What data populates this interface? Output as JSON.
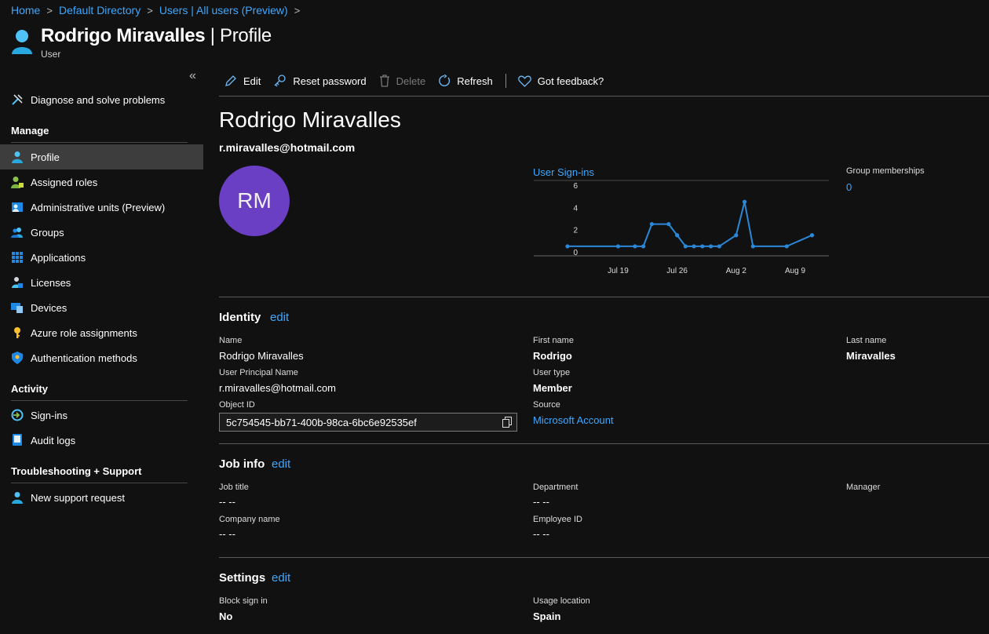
{
  "breadcrumb": [
    "Home",
    "Default Directory",
    "Users | All users (Preview)"
  ],
  "header": {
    "title_name": "Rodrigo Miravalles",
    "title_suffix": " | Profile",
    "subtitle": "User"
  },
  "sidebar": {
    "collapse_glyph": "«",
    "top_item": "Diagnose and solve problems",
    "sections": {
      "manage": "Manage",
      "activity": "Activity",
      "troubleshooting": "Troubleshooting + Support"
    },
    "manage_items": [
      "Profile",
      "Assigned roles",
      "Administrative units (Preview)",
      "Groups",
      "Applications",
      "Licenses",
      "Devices",
      "Azure role assignments",
      "Authentication methods"
    ],
    "activity_items": [
      "Sign-ins",
      "Audit logs"
    ],
    "support_items": [
      "New support request"
    ],
    "active_item": "Profile"
  },
  "toolbar": {
    "edit": "Edit",
    "reset_password": "Reset password",
    "delete": "Delete",
    "refresh": "Refresh",
    "feedback": "Got feedback?"
  },
  "profile": {
    "name": "Rodrigo Miravalles",
    "email": "r.miravalles@hotmail.com",
    "initials": "RM",
    "group_memberships_label": "Group memberships",
    "group_memberships_value": "0"
  },
  "chart_data": {
    "type": "line",
    "title": "User Sign-ins",
    "x_tick_labels": [
      "Jul 19",
      "Jul 26",
      "Aug 2",
      "Aug 9"
    ],
    "y_ticks": [
      0,
      2,
      4,
      6
    ],
    "ylim": [
      0,
      6
    ],
    "x": [
      -6,
      0,
      2,
      3,
      4,
      6,
      7,
      8,
      9,
      10,
      11,
      12,
      14,
      15,
      16,
      20,
      23
    ],
    "values": [
      0.5,
      0.5,
      0.5,
      0.5,
      2.5,
      2.5,
      1.5,
      0.5,
      0.5,
      0.5,
      0.5,
      0.5,
      1.5,
      4.5,
      0.5,
      0.5,
      1.5
    ],
    "color": "#2b88d8",
    "grid": false
  },
  "identity": {
    "title": "Identity",
    "edit": "edit",
    "name_label": "Name",
    "name": "Rodrigo Miravalles",
    "first_name_label": "First name",
    "first_name": "Rodrigo",
    "last_name_label": "Last name",
    "last_name": "Miravalles",
    "upn_label": "User Principal Name",
    "upn": "r.miravalles@hotmail.com",
    "user_type_label": "User type",
    "user_type": "Member",
    "object_id_label": "Object ID",
    "object_id": "5c754545-bb71-400b-98ca-6bc6e92535ef",
    "source_label": "Source",
    "source": "Microsoft Account"
  },
  "job_info": {
    "title": "Job info",
    "edit": "edit",
    "job_title_label": "Job title",
    "job_title": "-- --",
    "department_label": "Department",
    "department": "-- --",
    "manager_label": "Manager",
    "company_label": "Company name",
    "company": "-- --",
    "employee_id_label": "Employee ID",
    "employee_id": "-- --"
  },
  "settings": {
    "title": "Settings",
    "edit": "edit",
    "block_label": "Block sign in",
    "block": "No",
    "usage_label": "Usage location",
    "usage": "Spain"
  }
}
